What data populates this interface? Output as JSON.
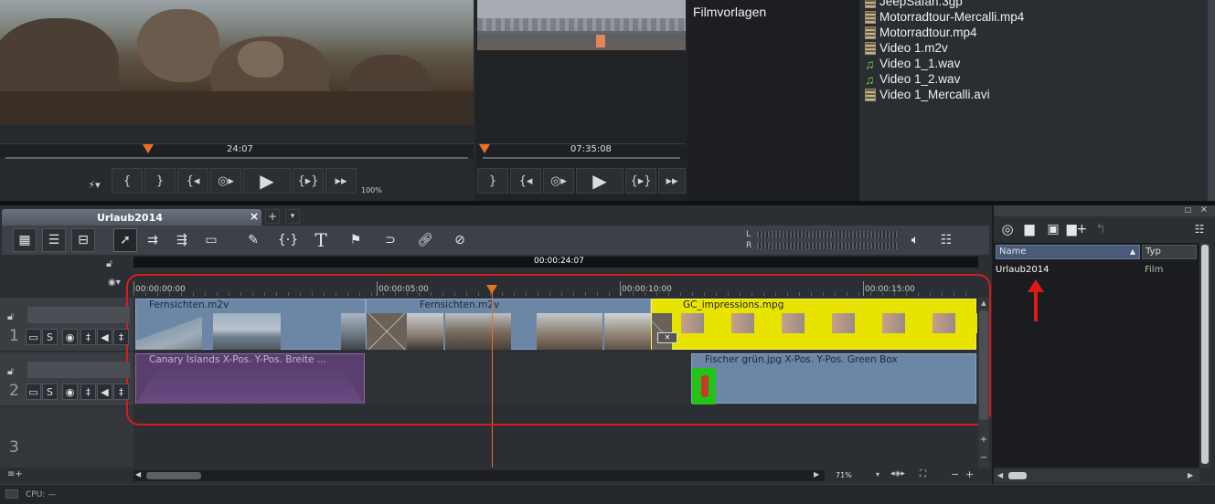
{
  "left_monitor": {
    "timecode": "24:07",
    "zoom": "100%"
  },
  "right_monitor": {
    "timecode": "07:35:08"
  },
  "media_pool": {
    "folder_label": "Filmvorlagen",
    "files": [
      {
        "name": "JeepSafari.3gp",
        "type": "video"
      },
      {
        "name": "Motorradtour-Mercalli.mp4",
        "type": "video"
      },
      {
        "name": "Motorradtour.mp4",
        "type": "video"
      },
      {
        "name": "Video 1.m2v",
        "type": "video"
      },
      {
        "name": "Video 1_1.wav",
        "type": "audio"
      },
      {
        "name": "Video 1_2.wav",
        "type": "audio"
      },
      {
        "name": "Video 1_Mercalli.avi",
        "type": "video"
      }
    ]
  },
  "project": {
    "tab_title": "Urlaub2014",
    "current_time": "00:00:24:07",
    "ruler_labels": [
      "00:00:00:00",
      "00:00:05:00",
      "00:00:10:00",
      "00:00:15:00"
    ],
    "zoom": "71%"
  },
  "tracks": [
    {
      "number": "1",
      "clips": [
        {
          "label": "Fernsichten.m2v"
        },
        {
          "label": "Fernsichten.m2v"
        },
        {
          "label": "GC_impressions.mpg"
        }
      ]
    },
    {
      "number": "2",
      "clips": [
        {
          "label": "Canary Islands   X-Pos.  Y-Pos.  Breite ..."
        },
        {
          "label": "Fischer grün.jpg   X-Pos.  Y-Pos. Green Box"
        }
      ]
    },
    {
      "number": "3",
      "clips": []
    }
  ],
  "track_controls": {
    "solo": "S"
  },
  "manager": {
    "columns": [
      "Name",
      "Typ"
    ],
    "rows": [
      {
        "name": "Urlaub2014",
        "type": "Film"
      }
    ]
  },
  "status": {
    "cpu": "CPU: —"
  },
  "colors": {
    "accent": "#e8731e",
    "selection": "#e01818",
    "yellow_clip": "#e8e400",
    "video_clip": "#6a87a8",
    "title_clip": "#5a3f6e"
  }
}
